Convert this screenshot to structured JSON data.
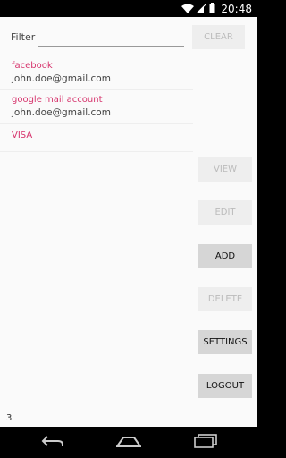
{
  "status_bar": {
    "time": "20:48"
  },
  "filter": {
    "label": "Filter",
    "value": ""
  },
  "buttons": {
    "clear": "CLEAR",
    "view": "VIEW",
    "edit": "EDIT",
    "add": "ADD",
    "delete": "DELETE",
    "settings": "SETTINGS",
    "logout": "LOGOUT"
  },
  "items": [
    {
      "title": "facebook",
      "account": "john.doe@gmail.com"
    },
    {
      "title": "google mail account",
      "account": "john.doe@gmail.com"
    },
    {
      "title": "VISA"
    }
  ],
  "count": "3",
  "colors": {
    "accent": "#d6336c"
  }
}
